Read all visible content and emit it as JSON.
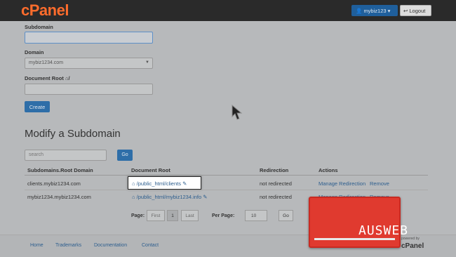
{
  "header": {
    "logo": "cPanel",
    "user_label": "mybiz123",
    "logout_label": "Logout"
  },
  "form": {
    "subdomain_label": "Subdomain",
    "subdomain_value": "",
    "domain_label": "Domain",
    "domain_value": "mybiz1234.com",
    "docroot_label": "Document Root",
    "docroot_suffix": "/",
    "docroot_value": "",
    "create_label": "Create"
  },
  "modify": {
    "title": "Modify a Subdomain",
    "search_placeholder": "search",
    "go_label": "Go",
    "columns": [
      "Subdomains.Root Domain",
      "Document Root",
      "Redirection",
      "Actions"
    ],
    "rows": [
      {
        "subdomain": "clients.mybiz1234.com",
        "docroot": "/public_html/clients",
        "redirection": "not redirected",
        "manage": "Manage Redirection",
        "remove": "Remove"
      },
      {
        "subdomain": "mybiz1234.mybiz1234.com",
        "docroot": "/public_html/mybiz1234.info",
        "redirection": "not redirected",
        "manage": "Manage Redirection",
        "remove": "Remove"
      }
    ],
    "pager": {
      "page_label": "Page:",
      "first": "First",
      "current": "1",
      "last": "Last",
      "per_page_label": "Per Page:",
      "per_page_value": "10",
      "go_label": "Go"
    }
  },
  "footer": {
    "links": [
      "Home",
      "Trademarks",
      "Documentation",
      "Contact"
    ],
    "powered_by": "powered by",
    "powered_logo": "cPanel"
  },
  "watermark": {
    "text": "AUSWEB"
  },
  "colors": {
    "brand_orange": "#ff6c2c",
    "primary_blue": "#2e6ea8",
    "watermark_red": "#e03a2f"
  }
}
